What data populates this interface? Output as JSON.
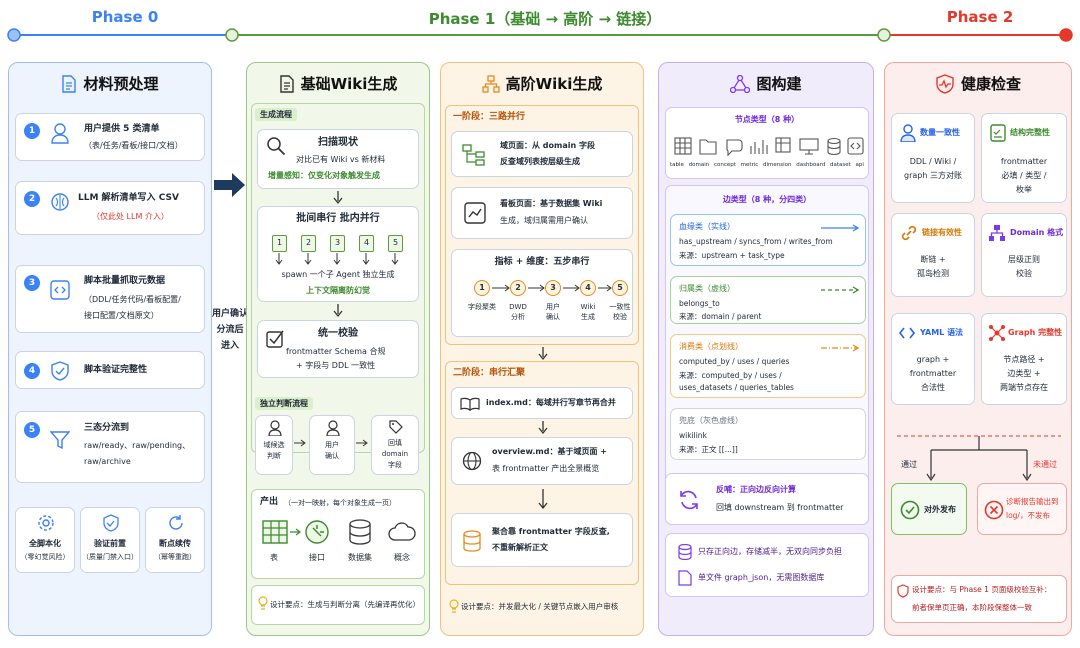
{
  "phases": {
    "p0": "Phase 0",
    "p1": "Phase 1（基础 → 高阶 → 链接）",
    "p2": "Phase 2"
  },
  "colors": {
    "blue": "#3b82f6",
    "green": "#5c9a3c",
    "orange": "#e58b1b",
    "purple": "#8b5cf6",
    "red": "#e5382b"
  },
  "col0": {
    "title": "材料预处理",
    "steps": [
      {
        "n": "1",
        "t1": "用户提供 5 类清单",
        "t2": "（表/任务/看板/接口/文档）"
      },
      {
        "n": "2",
        "t1": "LLM 解析清单写入 CSV",
        "t2": "（仅此处 LLM 介入）"
      },
      {
        "n": "3",
        "t1": "脚本批量抓取元数据",
        "t2": "（DDL/任务代码/看板配置/",
        "t3": "接口配置/文档原文）"
      },
      {
        "n": "4",
        "t1": "脚本验证完整性"
      },
      {
        "n": "5",
        "t1": "三态分流到",
        "t2": "raw/ready、raw/pending、",
        "t3": "raw/archive"
      }
    ],
    "foot": [
      {
        "a": "全脚本化",
        "b": "（零幻觉风险）"
      },
      {
        "a": "验证前置",
        "b": "（质量门禁入口）"
      },
      {
        "a": "断点续传",
        "b": "（幂等重跑）"
      }
    ]
  },
  "arrow_label": {
    "a": "用户确认",
    "b": "分流后",
    "c": "进入"
  },
  "col1": {
    "title": "基础Wiki生成",
    "sec1": "生成流程",
    "scan": {
      "t": "扫描现状",
      "d": "对比已有 Wiki vs 新材料",
      "g": "增量感知：仅变化对象触发生成"
    },
    "batch": {
      "t": "批间串行 批内并行",
      "nums": [
        "1",
        "2",
        "3",
        "4",
        "5"
      ],
      "d": "spawn 一个子 Agent 独立生成",
      "g": "上下文隔离防幻觉"
    },
    "check": {
      "t": "统一校验",
      "d1": "frontmatter Schema 合规",
      "d2": "+ 字段与 DDL 一致性"
    },
    "sec2": "独立判断流程",
    "judge": {
      "a1": "域候选",
      "a2": "判断",
      "b1": "用户",
      "b2": "确认",
      "c1": "回填",
      "c2": "domain",
      "c3": "字段"
    },
    "output": {
      "t": "产出",
      "note": "（一对一映射，每个对象生成一页）",
      "items": [
        "表",
        "接口",
        "数据集",
        "概念"
      ]
    },
    "tip": "设计要点：生成与判断分离（先编译再优化）"
  },
  "col2": {
    "title": "高阶Wiki生成",
    "sec1": "一阶段：三路并行",
    "domain": {
      "t1": "域页面：从 domain 字段",
      "t2": "反查域列表按层级生成"
    },
    "board": {
      "t1": "看板页面：基于数据集 Wiki",
      "t2": "生成，域归属需用户确认"
    },
    "metric": {
      "t": "指标 + 维度：五步串行",
      "nums": [
        "1",
        "2",
        "3",
        "4",
        "5"
      ],
      "steps": [
        [
          "字段聚类"
        ],
        [
          "DWD",
          "分析"
        ],
        [
          "用户",
          "确认"
        ],
        [
          "Wiki",
          "生成"
        ],
        [
          "一致性",
          "校验"
        ]
      ]
    },
    "sec2": "二阶段：串行汇聚",
    "index": "index.md：每域并行写章节再合并",
    "overview": {
      "t1": "overview.md：基于域页面 +",
      "t2": "表 frontmatter 产出全景概览"
    },
    "agg": {
      "t1": "聚合靠 frontmatter 字段反查,",
      "t2": "不重新解析正文"
    },
    "tip": "设计要点：并发最大化 / 关键节点嵌入用户审核"
  },
  "col3": {
    "title": "图构建",
    "node_title": "节点类型（8 种）",
    "nodes": [
      "table",
      "domain",
      "concept",
      "metric",
      "dimension",
      "dashboard",
      "dataset",
      "api"
    ],
    "edge_title": "边类型（8 种，分四类）",
    "edges": [
      {
        "name": "血缘类（实线）",
        "l1": "has_upstream / syncs_from / writes_from",
        "l2": "来源：upstream + task_type",
        "color": "#3b82f6"
      },
      {
        "name": "归属类（虚线）",
        "l1": "belongs_to",
        "l2": "来源：domain / parent",
        "color": "#3d8b2f"
      },
      {
        "name": "消费类（点划线）",
        "l1": "computed_by / uses / queries",
        "l2": "来源：computed_by / uses /",
        "l3": "uses_datasets / queries_tables",
        "color": "#e58b1b"
      },
      {
        "name": "兜底（灰色虚线）",
        "l1": "wikilink",
        "l2": "来源：正文 [[...]]",
        "color": "#6b7280"
      }
    ],
    "feed": {
      "t": "反哺：正向边反向计算",
      "d": "回填 downstream 到 frontmatter"
    },
    "s1": "只存正向边，存储减半，无双向同步负担",
    "s2": "单文件 graph_json，无需图数据库"
  },
  "col4": {
    "title": "健康检查",
    "checks": [
      {
        "t": "数量一致性",
        "d1": "DDL / Wiki /",
        "d2": "graph 三方对账"
      },
      {
        "t": "结构完整性",
        "d1": "frontmatter",
        "d2": "必填 / 类型 /",
        "d3": "枚举"
      },
      {
        "t": "链接有效性",
        "d1": "断链 +",
        "d2": "孤岛检测"
      },
      {
        "t": "Domain 格式",
        "d1": "层级正则",
        "d2": "校验"
      },
      {
        "t": "YAML 语法",
        "d1": "graph +",
        "d2": "frontmatter",
        "d3": "合法性"
      },
      {
        "t": "Graph 完整性",
        "d1": "节点路径 +",
        "d2": "边类型 +",
        "d3": "两端节点存在"
      }
    ],
    "pass": "通过",
    "fail": "未通过",
    "publish": "对外发布",
    "diag1": "诊断报告输出到",
    "diag2": "log/，不发布",
    "tip1": "设计要点：与 Phase 1 页面级校验互补：",
    "tip2": "前者保单页正确，本阶段保整体一致"
  }
}
